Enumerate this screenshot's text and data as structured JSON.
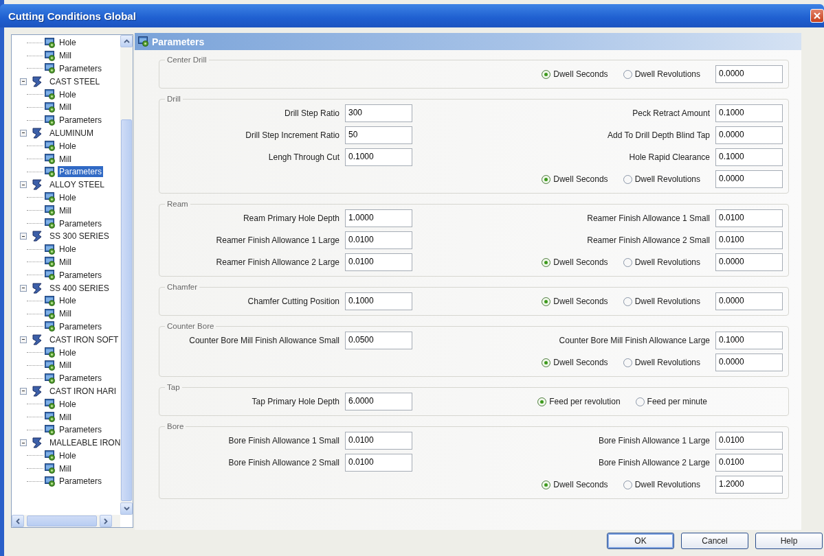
{
  "window": {
    "title": "Cutting Conditions Global"
  },
  "tree": {
    "items": [
      {
        "children": [
          {
            "label": "Hole",
            "selected": false
          },
          {
            "label": "Mill",
            "selected": false
          },
          {
            "label": "Parameters",
            "selected": false
          }
        ]
      },
      {
        "label": "CAST STEEL",
        "expanded": true,
        "children": [
          {
            "label": "Hole",
            "selected": false
          },
          {
            "label": "Mill",
            "selected": false
          },
          {
            "label": "Parameters",
            "selected": false
          }
        ]
      },
      {
        "label": "ALUMINUM",
        "expanded": true,
        "children": [
          {
            "label": "Hole",
            "selected": false
          },
          {
            "label": "Mill",
            "selected": false
          },
          {
            "label": "Parameters",
            "selected": true
          }
        ]
      },
      {
        "label": "ALLOY STEEL",
        "expanded": true,
        "children": [
          {
            "label": "Hole",
            "selected": false
          },
          {
            "label": "Mill",
            "selected": false
          },
          {
            "label": "Parameters",
            "selected": false
          }
        ]
      },
      {
        "label": "SS 300 SERIES",
        "expanded": true,
        "children": [
          {
            "label": "Hole",
            "selected": false
          },
          {
            "label": "Mill",
            "selected": false
          },
          {
            "label": "Parameters",
            "selected": false
          }
        ]
      },
      {
        "label": "SS 400 SERIES",
        "expanded": true,
        "children": [
          {
            "label": "Hole",
            "selected": false
          },
          {
            "label": "Mill",
            "selected": false
          },
          {
            "label": "Parameters",
            "selected": false
          }
        ]
      },
      {
        "label": "CAST IRON SOFT",
        "expanded": true,
        "children": [
          {
            "label": "Hole",
            "selected": false
          },
          {
            "label": "Mill",
            "selected": false
          },
          {
            "label": "Parameters",
            "selected": false
          }
        ]
      },
      {
        "label": "CAST IRON HARI",
        "expanded": true,
        "children": [
          {
            "label": "Hole",
            "selected": false
          },
          {
            "label": "Mill",
            "selected": false
          },
          {
            "label": "Parameters",
            "selected": false
          }
        ]
      },
      {
        "label": "MALLEABLE IRON",
        "expanded": true,
        "children": [
          {
            "label": "Hole",
            "selected": false
          },
          {
            "label": "Mill",
            "selected": false
          },
          {
            "label": "Parameters",
            "selected": false
          }
        ]
      }
    ]
  },
  "panel": {
    "title": "Parameters"
  },
  "groups": [
    {
      "title": "Center Drill",
      "right": [
        {
          "kind": "radio",
          "options": [
            {
              "label": "Dwell Seconds",
              "selected": true
            },
            {
              "label": "Dwell Revolutions",
              "selected": false
            }
          ],
          "value": "0.0000"
        }
      ]
    },
    {
      "title": "Drill",
      "left": [
        {
          "label": "Drill Step Ratio",
          "value": "300"
        },
        {
          "label": "Drill Step Increment Ratio",
          "value": "50"
        },
        {
          "label": "Lengh Through Cut",
          "value": "0.1000"
        }
      ],
      "right": [
        {
          "kind": "field",
          "label": "Peck Retract Amount",
          "value": "0.1000"
        },
        {
          "kind": "field",
          "label": "Add To Drill Depth Blind Tap",
          "value": "0.0000"
        },
        {
          "kind": "field",
          "label": "Hole Rapid Clearance",
          "value": "0.1000"
        },
        {
          "kind": "radio",
          "options": [
            {
              "label": "Dwell Seconds",
              "selected": true
            },
            {
              "label": "Dwell Revolutions",
              "selected": false
            }
          ],
          "value": "0.0000"
        }
      ]
    },
    {
      "title": "Ream",
      "left": [
        {
          "label": "Ream Primary Hole Depth",
          "value": "1.0000"
        },
        {
          "label": "Reamer Finish Allowance 1 Large",
          "value": "0.0100"
        },
        {
          "label": "Reamer Finish Allowance 2 Large",
          "value": "0.0100"
        }
      ],
      "right": [
        {
          "kind": "field",
          "label": "Reamer Finish Allowance 1 Small",
          "value": "0.0100"
        },
        {
          "kind": "field",
          "label": "Reamer Finish Allowance 2 Small",
          "value": "0.0100"
        },
        {
          "kind": "radio",
          "options": [
            {
              "label": "Dwell Seconds",
              "selected": true
            },
            {
              "label": "Dwell Revolutions",
              "selected": false
            }
          ],
          "value": "0.0000"
        }
      ]
    },
    {
      "title": "Chamfer",
      "left": [
        {
          "label": "Chamfer Cutting Position",
          "value": "0.1000"
        }
      ],
      "right": [
        {
          "kind": "radio",
          "options": [
            {
              "label": "Dwell Seconds",
              "selected": true
            },
            {
              "label": "Dwell Revolutions",
              "selected": false
            }
          ],
          "value": "0.0000"
        }
      ]
    },
    {
      "title": "Counter Bore",
      "left": [
        {
          "label": "Counter Bore Mill Finish Allowance Small",
          "value": "0.0500"
        }
      ],
      "right": [
        {
          "kind": "field",
          "label": "Counter Bore Mill Finish Allowance Large",
          "value": "0.1000"
        },
        {
          "kind": "radio",
          "options": [
            {
              "label": "Dwell Seconds",
              "selected": true
            },
            {
              "label": "Dwell Revolutions",
              "selected": false
            }
          ],
          "value": "0.0000"
        }
      ]
    },
    {
      "title": "Tap",
      "left": [
        {
          "label": "Tap Primary Hole Depth",
          "value": "6.0000"
        }
      ],
      "right": [
        {
          "kind": "radio",
          "options": [
            {
              "label": "Feed per revolution",
              "selected": true
            },
            {
              "label": "Feed per minute",
              "selected": false
            }
          ]
        }
      ]
    },
    {
      "title": "Bore",
      "left": [
        {
          "label": "Bore Finish Allowance 1 Small",
          "value": "0.0100"
        },
        {
          "label": "Bore Finish Allowance 2 Small",
          "value": "0.0100"
        }
      ],
      "right": [
        {
          "kind": "field",
          "label": "Bore Finish Allowance 1 Large",
          "value": "0.0100"
        },
        {
          "kind": "field",
          "label": "Bore Finish Allowance 2 Large",
          "value": "0.0100"
        },
        {
          "kind": "radio",
          "options": [
            {
              "label": "Dwell Seconds",
              "selected": true
            },
            {
              "label": "Dwell Revolutions",
              "selected": false
            }
          ],
          "value": "1.2000"
        }
      ]
    }
  ],
  "buttons": [
    {
      "label": "OK",
      "default": true
    },
    {
      "label": "Cancel",
      "default": false
    },
    {
      "label": "Help",
      "default": false
    }
  ]
}
